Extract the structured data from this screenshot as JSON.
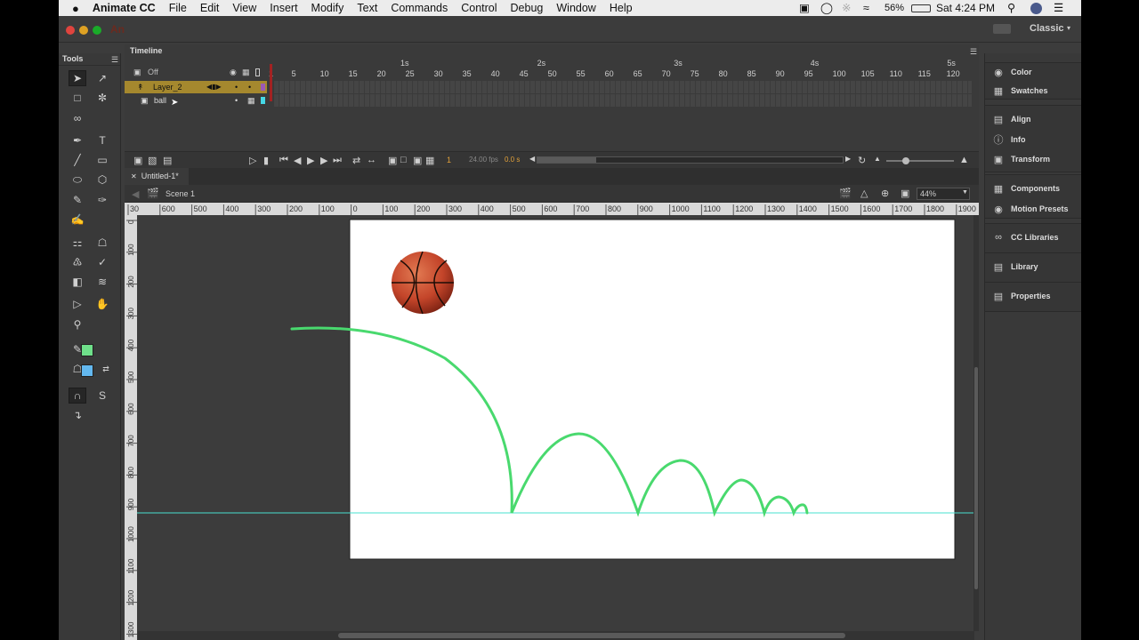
{
  "menubar": {
    "apple": "",
    "app": "Animate CC",
    "items": [
      "File",
      "Edit",
      "View",
      "Insert",
      "Modify",
      "Text",
      "Commands",
      "Control",
      "Debug",
      "Window",
      "Help"
    ],
    "battery": "56%",
    "clock": "Sat 4:24 PM"
  },
  "app": {
    "logo": "An",
    "workspace": "Classic"
  },
  "tools": {
    "title": "Tools"
  },
  "timeline": {
    "title": "Timeline",
    "header_label": "Off",
    "seconds": [
      "1s",
      "2s",
      "3s",
      "4s",
      "5s"
    ],
    "frame_numbers": [
      "1",
      "5",
      "10",
      "15",
      "20",
      "25",
      "30",
      "35",
      "40",
      "45",
      "50",
      "55",
      "60",
      "65",
      "70",
      "75",
      "80",
      "85",
      "90",
      "95",
      "100",
      "105",
      "110",
      "115",
      "120"
    ],
    "layers": [
      {
        "name": "Layer_2",
        "color": "#9b59b6"
      },
      {
        "name": "ball",
        "color": "#45d8e6"
      }
    ],
    "current_frame": "1",
    "fps": "24.00 fps",
    "time": "0.0 s"
  },
  "document": {
    "tab": "Untitled-1*",
    "scene": "Scene 1",
    "zoom": "44%"
  },
  "ruler": {
    "h_labels": [
      "30",
      "600",
      "500",
      "400",
      "300",
      "200",
      "100",
      "0",
      "100",
      "200",
      "300",
      "400",
      "500",
      "600",
      "700",
      "800",
      "900",
      "1000",
      "1100",
      "1200",
      "1300",
      "1400",
      "1500",
      "1600",
      "1700",
      "1800",
      "1900"
    ],
    "v_labels": [
      "0",
      "100",
      "200",
      "300",
      "400",
      "500",
      "600",
      "700",
      "800",
      "900",
      "1000",
      "1100",
      "1200",
      "1300"
    ]
  },
  "stage": {
    "background": "#ffffff",
    "path_color": "#49d96e",
    "guide_color": "#47e0cf"
  },
  "panels": {
    "items": [
      {
        "label": "Color",
        "icon": "color-wheel-icon"
      },
      {
        "label": "Swatches",
        "icon": "swatches-grid-icon"
      },
      {
        "label": "Align",
        "icon": "align-icon"
      },
      {
        "label": "Info",
        "icon": "info-icon"
      },
      {
        "label": "Transform",
        "icon": "transform-icon"
      },
      {
        "label": "Components",
        "icon": "components-icon"
      },
      {
        "label": "Motion Presets",
        "icon": "motion-presets-icon"
      },
      {
        "label": "CC Libraries",
        "icon": "cc-libraries-icon"
      },
      {
        "label": "Library",
        "icon": "library-icon"
      },
      {
        "label": "Properties",
        "icon": "properties-icon"
      }
    ]
  }
}
